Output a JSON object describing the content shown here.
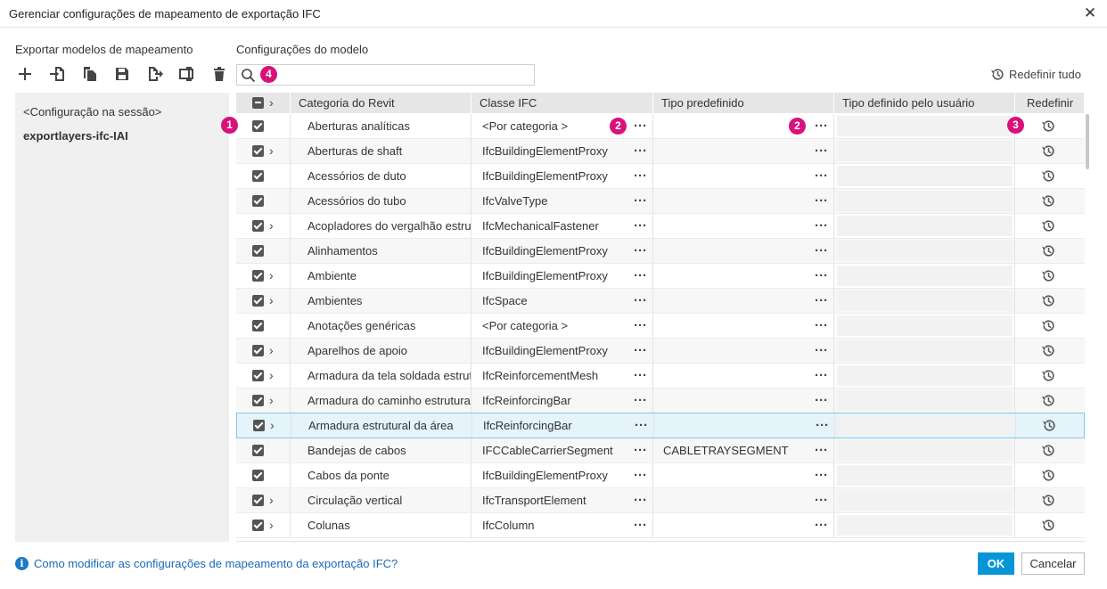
{
  "window": {
    "title": "Gerenciar configurações de mapeamento de exportação IFC"
  },
  "left": {
    "header": "Exportar modelos de mapeamento",
    "toolbar": [
      "add-icon",
      "import-icon",
      "copy-icon",
      "save-icon",
      "export-icon",
      "rename-icon",
      "delete-icon"
    ],
    "items": [
      "<Configuração na sessão>",
      "exportlayers-ifc-IAI"
    ]
  },
  "right": {
    "header": "Configurações do modelo",
    "search": {
      "value": "",
      "placeholder": ""
    },
    "reset_all": "Redefinir tudo"
  },
  "callouts": {
    "one": "1",
    "two": "2",
    "three": "3",
    "four": "4"
  },
  "table": {
    "columns": [
      "Categoria do Revit",
      "Classe IFC",
      "Tipo predefinido",
      "Tipo definido pelo usuário",
      "Redefinir"
    ],
    "more_label": "···",
    "rows": [
      {
        "category": "Aberturas analíticas",
        "ifc_class": "<Por categoria >",
        "predefined": "",
        "user_type": "",
        "expandable": false
      },
      {
        "category": "Aberturas de shaft",
        "ifc_class": "IfcBuildingElementProxy",
        "predefined": "",
        "user_type": "",
        "expandable": true
      },
      {
        "category": "Acessórios de duto",
        "ifc_class": "IfcBuildingElementProxy",
        "predefined": "",
        "user_type": "",
        "expandable": false
      },
      {
        "category": "Acessórios do tubo",
        "ifc_class": "IfcValveType",
        "predefined": "",
        "user_type": "",
        "expandable": false
      },
      {
        "category": "Acopladores do vergalhão estrutural",
        "ifc_class": "IfcMechanicalFastener",
        "predefined": "",
        "user_type": "",
        "expandable": true
      },
      {
        "category": "Alinhamentos",
        "ifc_class": "IfcBuildingElementProxy",
        "predefined": "",
        "user_type": "",
        "expandable": false
      },
      {
        "category": "Ambiente",
        "ifc_class": "IfcBuildingElementProxy",
        "predefined": "",
        "user_type": "",
        "expandable": true
      },
      {
        "category": "Ambientes",
        "ifc_class": "IfcSpace",
        "predefined": "",
        "user_type": "",
        "expandable": true
      },
      {
        "category": "Anotações genéricas",
        "ifc_class": "<Por categoria >",
        "predefined": "",
        "user_type": "",
        "expandable": false
      },
      {
        "category": "Aparelhos de apoio",
        "ifc_class": "IfcBuildingElementProxy",
        "predefined": "",
        "user_type": "",
        "expandable": true
      },
      {
        "category": "Armadura da tela soldada estrutural",
        "ifc_class": "IfcReinforcementMesh",
        "predefined": "",
        "user_type": "",
        "expandable": true
      },
      {
        "category": "Armadura do caminho estrutural",
        "ifc_class": "IfcReinforcingBar",
        "predefined": "",
        "user_type": "",
        "expandable": true
      },
      {
        "category": "Armadura estrutural da área",
        "ifc_class": "IfcReinforcingBar",
        "predefined": "",
        "user_type": "",
        "expandable": true,
        "selected": true
      },
      {
        "category": "Bandejas de cabos",
        "ifc_class": "IFCCableCarrierSegment",
        "predefined": "CABLETRAYSEGMENT",
        "user_type": "",
        "expandable": false
      },
      {
        "category": "Cabos da ponte",
        "ifc_class": "IfcBuildingElementProxy",
        "predefined": "",
        "user_type": "",
        "expandable": false
      },
      {
        "category": "Circulação vertical",
        "ifc_class": "IfcTransportElement",
        "predefined": "",
        "user_type": "",
        "expandable": true
      },
      {
        "category": "Colunas",
        "ifc_class": "IfcColumn",
        "predefined": "",
        "user_type": "",
        "expandable": true
      }
    ]
  },
  "footer": {
    "help_text": "Como modificar as configurações de mapeamento da exportação IFC?",
    "ok": "OK",
    "cancel": "Cancelar"
  },
  "colors": {
    "accent": "#0696d7",
    "callout": "#d9117a",
    "link": "#1b6ab3",
    "selection": "#e5f3fb"
  }
}
